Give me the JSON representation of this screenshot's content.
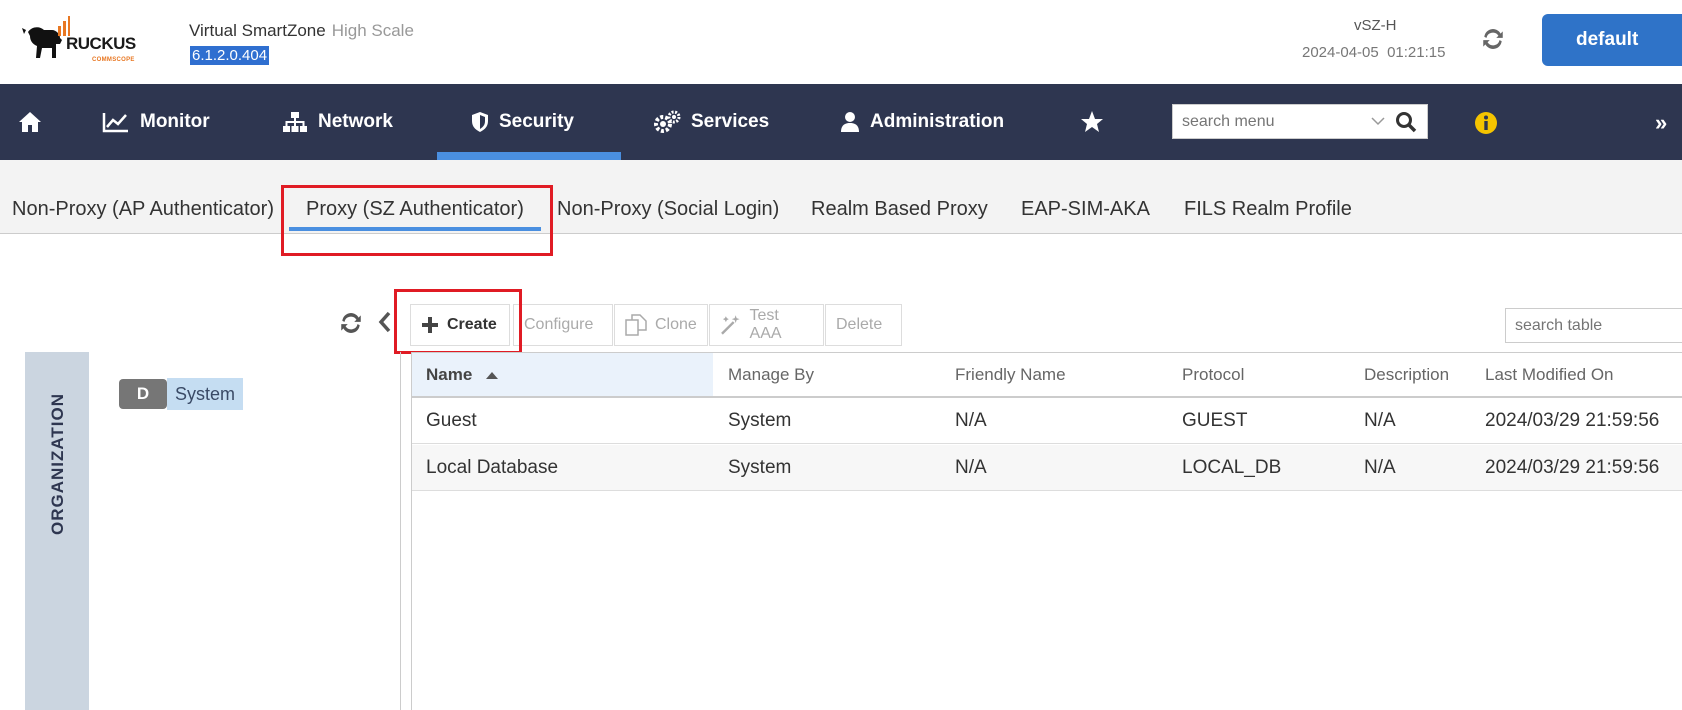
{
  "header": {
    "brand": "RUCKUS",
    "brand_sub": "COMMSCOPE",
    "product": "Virtual SmartZone",
    "edition": "High Scale",
    "version": "6.1.2.0.404",
    "host": "vSZ-H",
    "date": "2024-04-05",
    "time": "01:21:15",
    "default_label": "default"
  },
  "nav": {
    "items": [
      {
        "label": "Monitor"
      },
      {
        "label": "Network"
      },
      {
        "label": "Security"
      },
      {
        "label": "Services"
      },
      {
        "label": "Administration"
      }
    ],
    "search_placeholder": "search menu",
    "more_glyph": "»"
  },
  "subtabs": [
    {
      "label": "Non-Proxy (AP Authenticator)"
    },
    {
      "label": "Proxy (SZ Authenticator)"
    },
    {
      "label": "Non-Proxy (Social Login)"
    },
    {
      "label": "Realm Based Proxy"
    },
    {
      "label": "EAP-SIM-AKA"
    },
    {
      "label": "FILS Realm Profile"
    }
  ],
  "toolbar": {
    "create": "Create",
    "configure": "Configure",
    "clone": "Clone",
    "test": "Test AAA",
    "delete": "Delete",
    "search_placeholder": "search table"
  },
  "org": {
    "label": "ORGANIZATION",
    "node_badge": "D",
    "node_label": "System"
  },
  "table": {
    "columns": [
      "Name",
      "Manage By",
      "Friendly Name",
      "Protocol",
      "Description",
      "Last Modified On"
    ],
    "rows": [
      [
        "Guest",
        "System",
        "N/A",
        "GUEST",
        "N/A",
        "2024/03/29 21:59:56"
      ],
      [
        "Local Database",
        "System",
        "N/A",
        "LOCAL_DB",
        "N/A",
        "2024/03/29 21:59:56"
      ]
    ]
  },
  "colors": {
    "nav_bg": "#2e3650",
    "accent": "#4a8fe0",
    "primary_button": "#2f73c8",
    "highlight_box": "#e01b24",
    "info_icon": "#f5c400",
    "logo_orange": "#e87722"
  }
}
